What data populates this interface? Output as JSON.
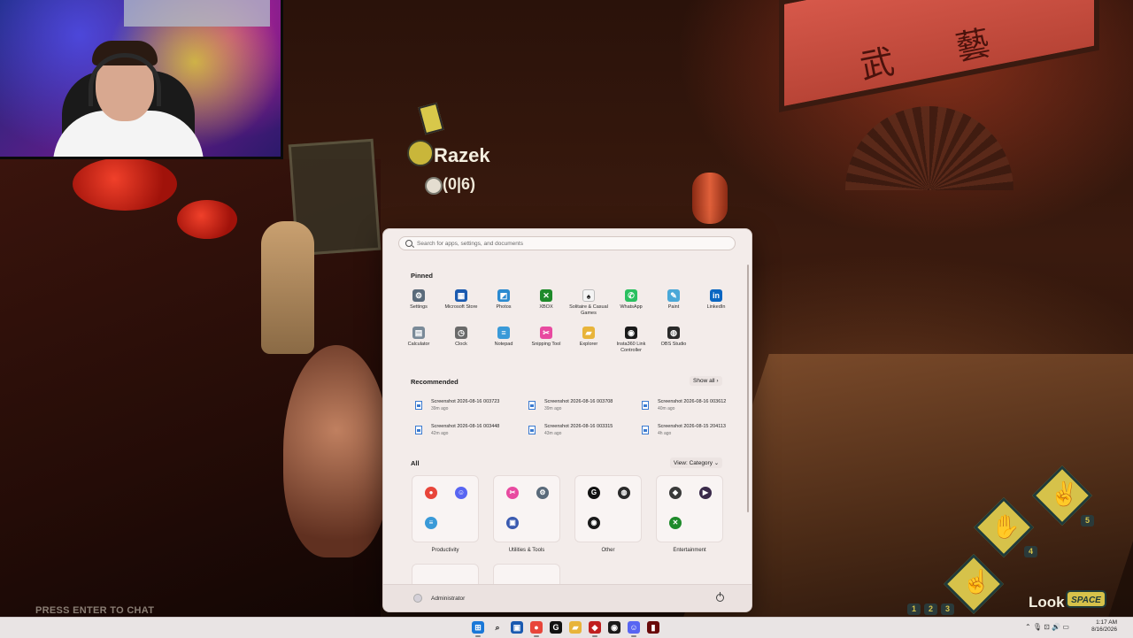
{
  "game": {
    "player": {
      "name": "Razek",
      "score": "(0|6)"
    },
    "chat_hint": "PRESS ENTER TO CHAT",
    "hud": {
      "look_label": "Look",
      "space_label": "SPACE",
      "key_hand": "4",
      "key_peace": "5",
      "key_row": [
        "1",
        "2",
        "3"
      ]
    },
    "banner_text": "武 藝"
  },
  "start_menu": {
    "search_placeholder": "Search for apps, settings, and documents",
    "pinned_label": "Pinned",
    "pinned": [
      {
        "label": "Settings",
        "icon": "gear-icon",
        "color": "#5a6a7a",
        "glyph": "⚙"
      },
      {
        "label": "Microsoft Store",
        "icon": "store-icon",
        "color": "#1a5ab0",
        "glyph": "▦"
      },
      {
        "label": "Photos",
        "icon": "photos-icon",
        "color": "#2a8ad0",
        "glyph": "◩"
      },
      {
        "label": "XBOX",
        "icon": "xbox-icon",
        "color": "#1e8a2a",
        "glyph": "✕"
      },
      {
        "label": "Solitaire & Casual Games",
        "icon": "cards-icon",
        "color": "#f4f4f4",
        "glyph": "♠"
      },
      {
        "label": "WhatsApp",
        "icon": "whatsapp-icon",
        "color": "#2ac060",
        "glyph": "✆"
      },
      {
        "label": "Paint",
        "icon": "paint-icon",
        "color": "#4aa8d8",
        "glyph": "✎"
      },
      {
        "label": "LinkedIn",
        "icon": "linkedin-icon",
        "color": "#0a66c2",
        "glyph": "in"
      },
      {
        "label": "Calculator",
        "icon": "calculator-icon",
        "color": "#7a8a98",
        "glyph": "▤"
      },
      {
        "label": "Clock",
        "icon": "clock-icon",
        "color": "#6a6a6a",
        "glyph": "◷"
      },
      {
        "label": "Notepad",
        "icon": "notepad-icon",
        "color": "#3a9ad8",
        "glyph": "≡"
      },
      {
        "label": "Snipping Tool",
        "icon": "scissors-icon",
        "color": "#e84aa0",
        "glyph": "✂"
      },
      {
        "label": "Explorer",
        "icon": "folder-icon",
        "color": "#e8b43a",
        "glyph": "▰"
      },
      {
        "label": "Insta360 Link Controller",
        "icon": "camera-icon",
        "color": "#1a1a1a",
        "glyph": "◉"
      },
      {
        "label": "OBS Studio",
        "icon": "obs-icon",
        "color": "#2a2a2a",
        "glyph": "◍"
      }
    ],
    "recommended_label": "Recommended",
    "show_all": "Show all  ›",
    "recommended": [
      {
        "name": "Screenshot 2026-08-16 003723",
        "time": "39m ago"
      },
      {
        "name": "Screenshot 2026-08-16 003708",
        "time": "39m ago"
      },
      {
        "name": "Screenshot 2026-08-16 003612",
        "time": "40m ago"
      },
      {
        "name": "Screenshot 2026-08-16 003448",
        "time": "42m ago"
      },
      {
        "name": "Screenshot 2026-08-16 003315",
        "time": "43m ago"
      },
      {
        "name": "Screenshot 2026-08-15 204113",
        "time": "4h ago"
      }
    ],
    "all_label": "All",
    "view_label": "View: Category  ⌄",
    "folders": [
      {
        "label": "Productivity",
        "icons": [
          {
            "name": "chrome-icon",
            "color": "#e8453a",
            "glyph": "●"
          },
          {
            "name": "discord-icon",
            "color": "#5865f2",
            "glyph": "☺"
          },
          {
            "name": "notepad-icon",
            "color": "#3a9ad8",
            "glyph": "≡"
          }
        ]
      },
      {
        "label": "Utilities & Tools",
        "icons": [
          {
            "name": "scissors-icon",
            "color": "#e84aa0",
            "glyph": "✂"
          },
          {
            "name": "gear-icon",
            "color": "#5a6a7a",
            "glyph": "⚙"
          },
          {
            "name": "remote-icon",
            "color": "#3a5ab0",
            "glyph": "▣"
          }
        ]
      },
      {
        "label": "Other",
        "icons": [
          {
            "name": "gg-icon",
            "color": "#111111",
            "glyph": "G"
          },
          {
            "name": "obs-icon",
            "color": "#2a2a2a",
            "glyph": "◍"
          },
          {
            "name": "camera-icon",
            "color": "#1a1a1a",
            "glyph": "◉"
          }
        ]
      },
      {
        "label": "Entertainment",
        "icons": [
          {
            "name": "game-icon",
            "color": "#3a3a3a",
            "glyph": "◆"
          },
          {
            "name": "media-player-icon",
            "color": "#3a2a4a",
            "glyph": "▶"
          },
          {
            "name": "xbox-icon",
            "color": "#1e8a2a",
            "glyph": "✕"
          }
        ]
      }
    ],
    "user_name": "Administrator"
  },
  "taskbar": {
    "apps": [
      {
        "name": "start-icon",
        "color": "#1a78d8",
        "glyph": "⊞"
      },
      {
        "name": "search-icon",
        "color": "#e9e4e4",
        "glyph": "⌕"
      },
      {
        "name": "task-view-icon",
        "color": "#1a5ab0",
        "glyph": "▣"
      },
      {
        "name": "chrome-icon",
        "color": "#e8453a",
        "glyph": "●"
      },
      {
        "name": "gg-icon",
        "color": "#111111",
        "glyph": "G"
      },
      {
        "name": "folder-icon",
        "color": "#e8b43a",
        "glyph": "▰"
      },
      {
        "name": "game-icon",
        "color": "#c02020",
        "glyph": "◆"
      },
      {
        "name": "camera-icon",
        "color": "#1a1a1a",
        "glyph": "◉"
      },
      {
        "name": "discord-icon",
        "color": "#5865f2",
        "glyph": "☺"
      },
      {
        "name": "game-window-icon",
        "color": "#6a0a0a",
        "glyph": "▮"
      }
    ],
    "tray_glyphs": "⌃  🎙 ⊡ 🔊 ▭",
    "time": "1:17 AM",
    "date": "8/16/2026"
  }
}
